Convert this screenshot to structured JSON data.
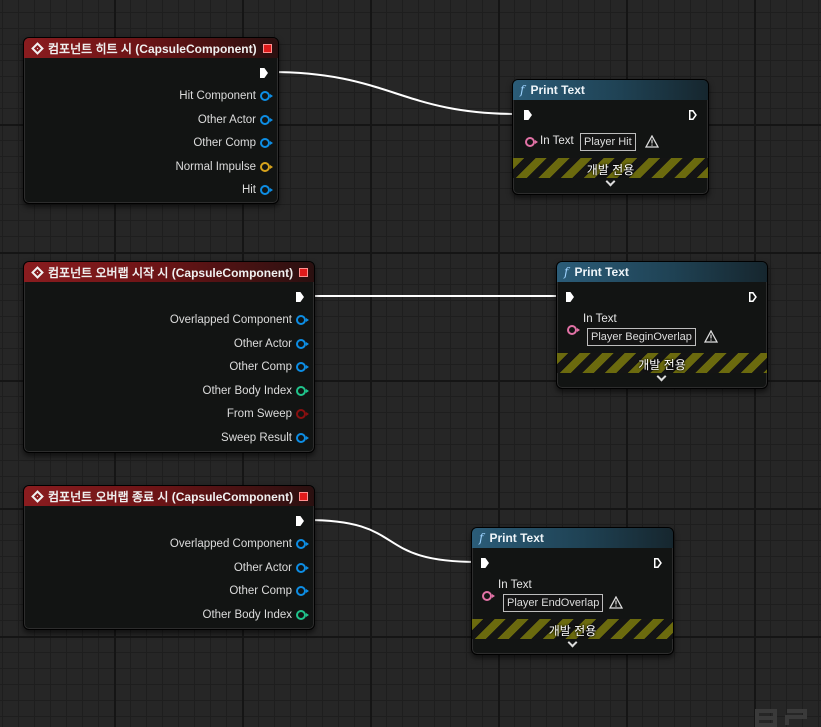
{
  "event_nodes": [
    {
      "title": "컴포넌트 히트 시 (CapsuleComponent)",
      "pins": [
        {
          "label": "Hit Component",
          "type": "object"
        },
        {
          "label": "Other Actor",
          "type": "object"
        },
        {
          "label": "Other Comp",
          "type": "object"
        },
        {
          "label": "Normal Impulse",
          "type": "vector"
        },
        {
          "label": "Hit",
          "type": "struct"
        }
      ]
    },
    {
      "title": "컴포넌트 오버랩 시작 시 (CapsuleComponent)",
      "pins": [
        {
          "label": "Overlapped Component",
          "type": "object"
        },
        {
          "label": "Other Actor",
          "type": "object"
        },
        {
          "label": "Other Comp",
          "type": "object"
        },
        {
          "label": "Other Body Index",
          "type": "int"
        },
        {
          "label": "From Sweep",
          "type": "bool"
        },
        {
          "label": "Sweep Result",
          "type": "struct"
        }
      ]
    },
    {
      "title": "컴포넌트 오버랩 종료 시 (CapsuleComponent)",
      "pins": [
        {
          "label": "Overlapped Component",
          "type": "object"
        },
        {
          "label": "Other Actor",
          "type": "object"
        },
        {
          "label": "Other Comp",
          "type": "object"
        },
        {
          "label": "Other Body Index",
          "type": "int"
        }
      ]
    }
  ],
  "print_nodes": [
    {
      "title": "Print Text",
      "in_text_label": "In Text",
      "in_text_value": "Player Hit",
      "dev_only": "개발 전용",
      "icon": "function-icon"
    },
    {
      "title": "Print Text",
      "in_text_label": "In Text",
      "in_text_value": "Player BeginOverlap",
      "dev_only": "개발 전용",
      "icon": "function-icon"
    },
    {
      "title": "Print Text",
      "in_text_label": "In Text",
      "in_text_value": "Player EndOverlap",
      "dev_only": "개발 전용",
      "icon": "function-icon"
    }
  ],
  "colors": {
    "event_header": "#8a1c1f",
    "function_header": "#2b5c78",
    "object_pin": "#0d8ee5",
    "vector_pin": "#d7a31c",
    "int_pin": "#20c48c",
    "bool_pin": "#8a1010",
    "text_pin": "#e272a6",
    "exec_wire": "#ffffff"
  }
}
